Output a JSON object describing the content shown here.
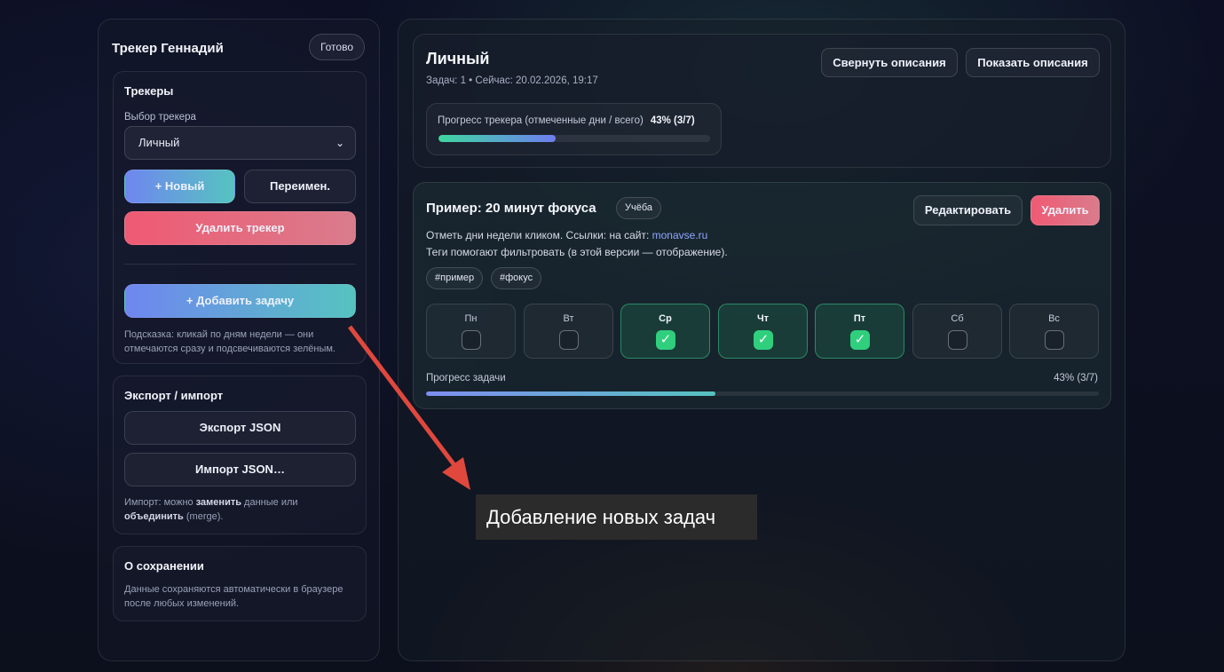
{
  "sidebar": {
    "title": "Трекер Геннадий",
    "ready_badge": "Готово",
    "trackers_card": {
      "title": "Трекеры",
      "select_label": "Выбор трекера",
      "selected_tracker": "Личный",
      "new_button": "+ Новый",
      "rename_button": "Переимен.",
      "delete_button": "Удалить трекер",
      "add_task_button": "+ Добавить задачу",
      "hint": "Подсказка: кликай по дням недели — они отмечаются сразу и подсвечиваются зелёным."
    },
    "export_card": {
      "title": "Экспорт / импорт",
      "export_button": "Экспорт JSON",
      "import_button": "Импорт JSON…",
      "hint_prefix": "Импорт: можно ",
      "hint_bold1": "заменить",
      "hint_mid": " данные или ",
      "hint_bold2": "объединить",
      "hint_suffix": " (merge)."
    },
    "save_card": {
      "title": "О сохранении",
      "text": "Данные сохраняются автоматически в браузере после любых изменений."
    }
  },
  "tracker": {
    "title": "Личный",
    "meta": "Задач: 1 • Сейчас: 20.02.2026, 19:17",
    "collapse_button": "Свернуть описания",
    "show_button": "Показать описания",
    "progress_label": "Прогресс трекера (отмеченные дни / всего)",
    "progress_value": "43% (3/7)",
    "progress_fraction": 0.43
  },
  "task": {
    "title": "Пример: 20 минут фокуса",
    "category": "Учёба",
    "edit_button": "Редактировать",
    "delete_button": "Удалить",
    "desc_line1_prefix": "Отметь дни недели кликом. Ссылки: на сайт: ",
    "desc_link": "monavse.ru",
    "desc_line2": "Теги помогают фильтровать (в этой версии — отображение).",
    "tags": [
      "#пример",
      "#фокус"
    ],
    "days": [
      {
        "name": "Пн",
        "checked": false
      },
      {
        "name": "Вт",
        "checked": false
      },
      {
        "name": "Ср",
        "checked": true
      },
      {
        "name": "Чт",
        "checked": true
      },
      {
        "name": "Пт",
        "checked": true
      },
      {
        "name": "Сб",
        "checked": false
      },
      {
        "name": "Вс",
        "checked": false
      }
    ],
    "check_glyph": "✓",
    "progress_label": "Прогресс задачи",
    "progress_value": "43% (3/7)",
    "progress_fraction": 0.43
  },
  "annotation": {
    "callout_text": "Добавление новых задач",
    "arrow_color": "#e0483d"
  },
  "colors": {
    "tracker_bar": [
      "#3fd6a0",
      "#6e7ef0"
    ],
    "task_bar": [
      "#7f8ef0",
      "#56c3c0"
    ]
  }
}
